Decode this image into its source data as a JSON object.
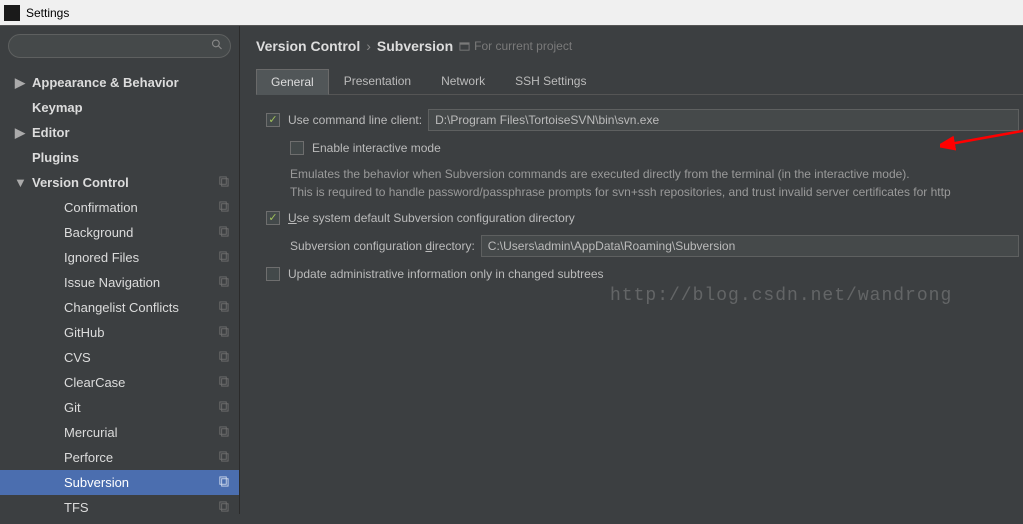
{
  "window": {
    "title": "Settings"
  },
  "search": {
    "placeholder": ""
  },
  "sidebar": {
    "items": [
      {
        "label": "Appearance & Behavior",
        "bold": true,
        "arrow": "▶",
        "level": 0
      },
      {
        "label": "Keymap",
        "bold": true,
        "level": 0
      },
      {
        "label": "Editor",
        "bold": true,
        "arrow": "▶",
        "level": 0
      },
      {
        "label": "Plugins",
        "bold": true,
        "level": 0
      },
      {
        "label": "Version Control",
        "bold": true,
        "arrow": "▼",
        "level": 0,
        "copy": true
      },
      {
        "label": "Confirmation",
        "level": 1,
        "copy": true
      },
      {
        "label": "Background",
        "level": 1,
        "copy": true
      },
      {
        "label": "Ignored Files",
        "level": 1,
        "copy": true
      },
      {
        "label": "Issue Navigation",
        "level": 1,
        "copy": true
      },
      {
        "label": "Changelist Conflicts",
        "level": 1,
        "copy": true
      },
      {
        "label": "GitHub",
        "level": 1,
        "copy": true
      },
      {
        "label": "CVS",
        "level": 1,
        "copy": true
      },
      {
        "label": "ClearCase",
        "level": 1,
        "copy": true
      },
      {
        "label": "Git",
        "level": 1,
        "copy": true
      },
      {
        "label": "Mercurial",
        "level": 1,
        "copy": true
      },
      {
        "label": "Perforce",
        "level": 1,
        "copy": true
      },
      {
        "label": "Subversion",
        "level": 1,
        "copy": true,
        "selected": true
      },
      {
        "label": "TFS",
        "level": 1,
        "copy": true
      }
    ]
  },
  "breadcrumb": {
    "part1": "Version Control",
    "sep": "›",
    "part2": "Subversion",
    "hint": "For current project"
  },
  "tabs": [
    "General",
    "Presentation",
    "Network",
    "SSH Settings"
  ],
  "panel": {
    "useCmdLine": {
      "label": "Use command line client:",
      "checked": true,
      "value": "D:\\Program Files\\TortoiseSVN\\bin\\svn.exe"
    },
    "enableInteractive": {
      "label": "Enable interactive mode",
      "checked": false
    },
    "desc1": "Emulates the behavior when Subversion commands are executed directly from the terminal (in the interactive mode).",
    "desc2": "This is required to handle password/passphrase prompts for svn+ssh repositories, and trust invalid server certificates for http",
    "useSysDefault": {
      "label_pre": "U",
      "label_post": "se system default Subversion configuration directory",
      "checked": true
    },
    "configDir": {
      "label_pre": "Subversion configuration ",
      "label_u": "d",
      "label_post": "irectory:",
      "value": "C:\\Users\\admin\\AppData\\Roaming\\Subversion"
    },
    "updateAdmin": {
      "label": "Update administrative information only in changed subtrees",
      "checked": false
    }
  },
  "watermark": "http://blog.csdn.net/wandrong"
}
